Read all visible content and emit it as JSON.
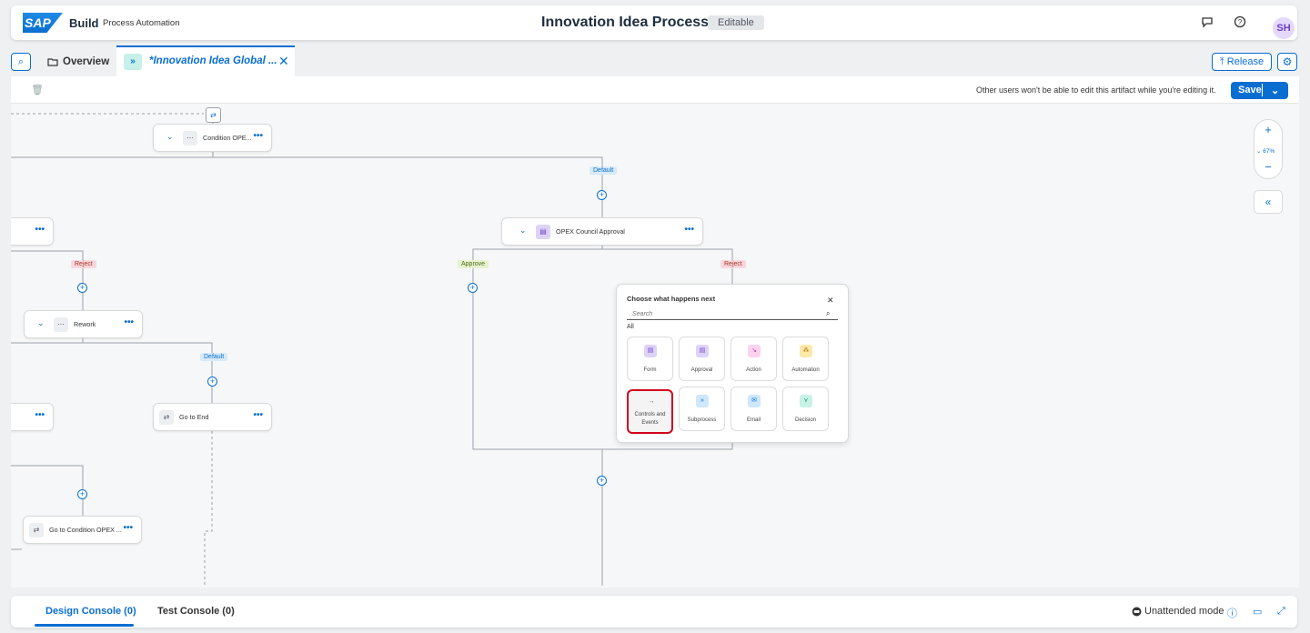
{
  "header": {
    "logo_text": "SAP",
    "brand": "Build",
    "product": "Process Automation",
    "title": "Innovation Idea Process",
    "status_badge": "Editable",
    "avatar_initials": "SH"
  },
  "tabs": {
    "overview_label": "Overview",
    "active_tab_label": "*Innovation Idea Global ...",
    "release_label": "Release"
  },
  "toolbar": {
    "lock_notice": "Other users won't be able to edit this artifact while you're editing it.",
    "save_label": "Save"
  },
  "canvas": {
    "nodes": {
      "condition_opex": "Condition OPE...",
      "opex_council_approval": "OPEX Council Approval",
      "rework": "Rework",
      "go_to_end": "Go to End",
      "go_to_condition": "Go to Condition OPEX ..."
    },
    "branch_labels": {
      "default": "Default",
      "reject": "Reject",
      "approve": "Approve"
    },
    "zoom_level": "67%"
  },
  "popup": {
    "title": "Choose what happens next",
    "search_placeholder": "Search",
    "group_label": "All",
    "options": [
      {
        "label": "Form",
        "icon": "form-icon",
        "color": "#ddd2f7"
      },
      {
        "label": "Approval",
        "icon": "approval-icon",
        "color": "#ddd2f7"
      },
      {
        "label": "Action",
        "icon": "action-icon",
        "color": "#fbd3ee"
      },
      {
        "label": "Automation",
        "icon": "automation-icon",
        "color": "#fde9a8"
      },
      {
        "label": "Controls and Events",
        "icon": "arrow-right-icon",
        "color": "#ececec"
      },
      {
        "label": "Subprocess",
        "icon": "subprocess-icon",
        "color": "#cfe6fb"
      },
      {
        "label": "Email",
        "icon": "email-icon",
        "color": "#cfe6fb"
      },
      {
        "label": "Decision",
        "icon": "decision-icon",
        "color": "#c7f2e6"
      }
    ],
    "selected_option": "Controls and Events"
  },
  "console": {
    "design_tab": "Design Console (0)",
    "test_tab": "Test Console (0)",
    "mode_label": "Unattended mode"
  },
  "colors": {
    "accent": "#0a6ed1",
    "highlight": "#d0021b"
  }
}
